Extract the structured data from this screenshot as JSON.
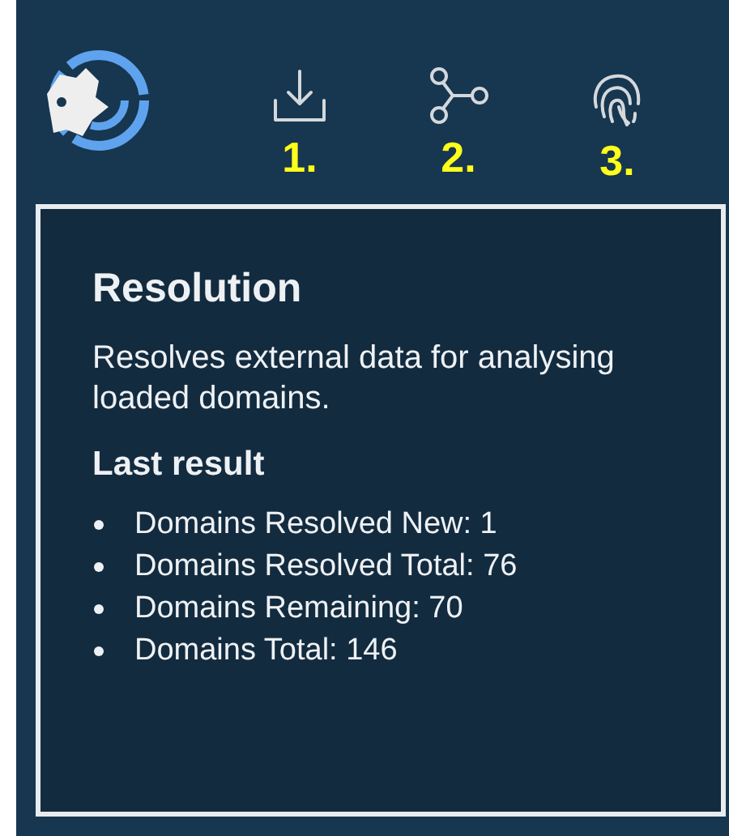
{
  "toolbar": {
    "steps": [
      {
        "kind": "import",
        "number": "1."
      },
      {
        "kind": "resolve",
        "number": "2."
      },
      {
        "kind": "fingerprint",
        "number": "3."
      }
    ]
  },
  "tooltip": {
    "title": "Resolution",
    "description": "Resolves external data for analysing loaded domains.",
    "section_title": "Last result",
    "results": [
      "Domains Resolved New: 1",
      "Domains Resolved Total: 76",
      "Domains Remaining: 70",
      "Domains Total: 146"
    ]
  }
}
